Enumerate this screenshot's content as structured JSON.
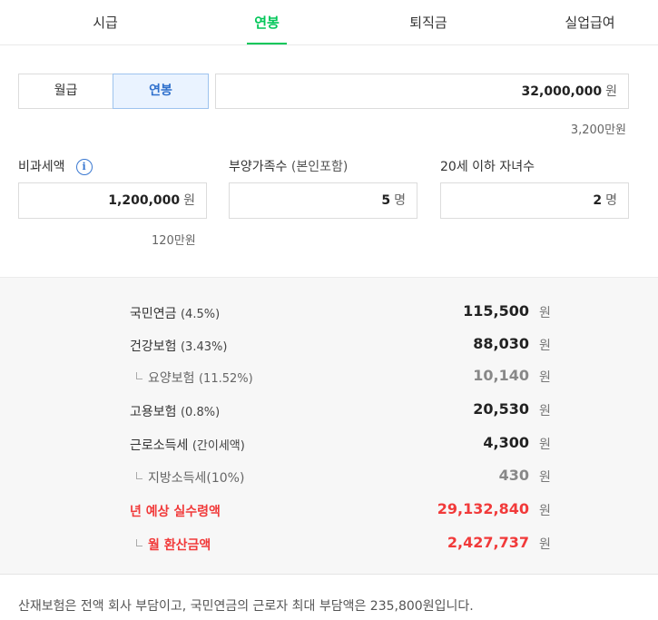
{
  "tabs": [
    {
      "label": "시급",
      "active": false
    },
    {
      "label": "연봉",
      "active": true
    },
    {
      "label": "퇴직금",
      "active": false
    },
    {
      "label": "실업급여",
      "active": false
    }
  ],
  "pay_type": {
    "options": [
      "월급",
      "연봉"
    ],
    "selected": "연봉"
  },
  "salary": {
    "value": "32,000,000",
    "unit": "원",
    "hint": "3,200만원"
  },
  "nontax": {
    "label": "비과세액",
    "value": "1,200,000",
    "unit": "원",
    "hint": "120만원"
  },
  "dependents": {
    "label": "부양가족수",
    "label_paren": "(본인포함)",
    "value": "5",
    "unit": "명"
  },
  "children": {
    "label": "20세 이하 자녀수",
    "value": "2",
    "unit": "명"
  },
  "results": [
    {
      "name": "국민연금",
      "pct": "(4.5%)",
      "amount": "115,500",
      "unit": "원",
      "sub": false,
      "highlight": false
    },
    {
      "name": "건강보험",
      "pct": "(3.43%)",
      "amount": "88,030",
      "unit": "원",
      "sub": false,
      "highlight": false
    },
    {
      "name": "요양보험",
      "pct": "(11.52%)",
      "amount": "10,140",
      "unit": "원",
      "sub": true,
      "highlight": false
    },
    {
      "name": "고용보험",
      "pct": "(0.8%)",
      "amount": "20,530",
      "unit": "원",
      "sub": false,
      "highlight": false
    },
    {
      "name": "근로소득세",
      "pct": "(간이세액)",
      "amount": "4,300",
      "unit": "원",
      "sub": false,
      "highlight": false
    },
    {
      "name": "지방소득세(10%)",
      "pct": "",
      "amount": "430",
      "unit": "원",
      "sub": true,
      "highlight": false
    },
    {
      "name": "년 예상 실수령액",
      "pct": "",
      "amount": "29,132,840",
      "unit": "원",
      "sub": false,
      "highlight": true
    },
    {
      "name": "월 환산금액",
      "pct": "",
      "amount": "2,427,737",
      "unit": "원",
      "sub": true,
      "highlight": true
    }
  ],
  "footer_note": "산재보험은 전액 회사 부담이고, 국민연금의 근로자 최대 부담액은 235,800원입니다.",
  "colors": {
    "accent_green": "#03c75a",
    "highlight_red": "#f13a3a",
    "selected_blue": "#2f70cc"
  }
}
